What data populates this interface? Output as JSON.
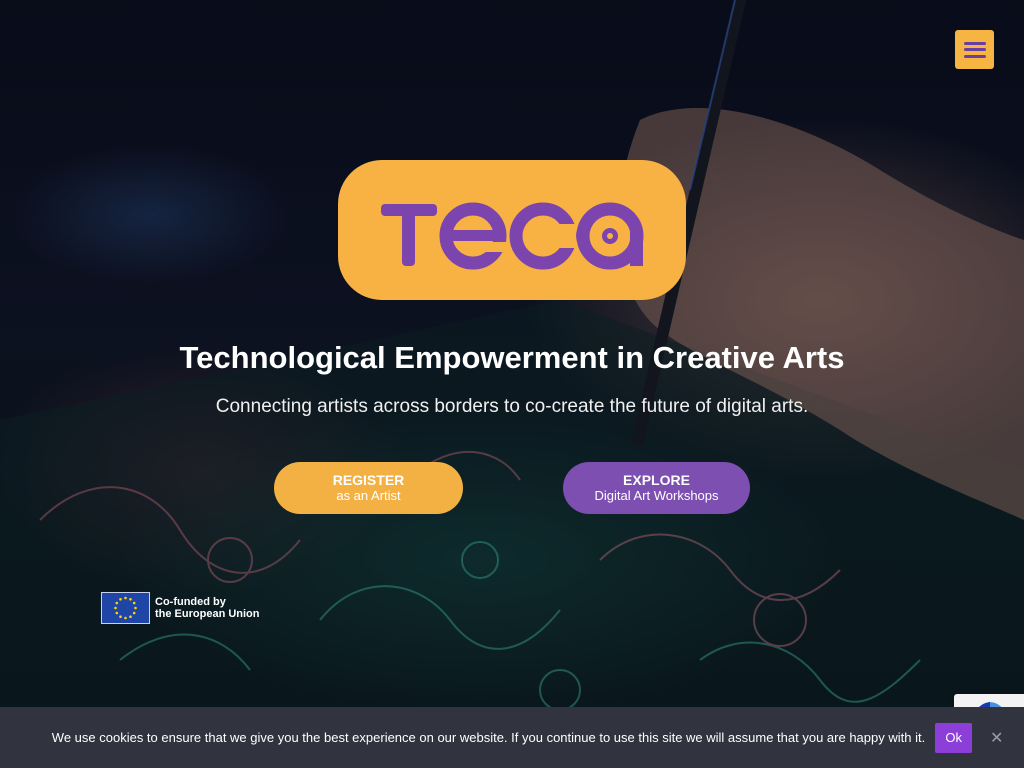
{
  "header": {
    "menu_icon": "hamburger-icon"
  },
  "logo": {
    "text": "TECA"
  },
  "hero": {
    "headline": "Technological Empowerment in Creative Arts",
    "subline": "Connecting artists across borders to co-create the future of digital arts."
  },
  "cta": {
    "register": {
      "line1": "REGISTER",
      "line2": "as an Artist"
    },
    "explore": {
      "line1": "EXPLORE",
      "line2": "Digital Art Workshops"
    }
  },
  "eu_badge": {
    "line1": "Co-funded by",
    "line2": "the European Union"
  },
  "cookie": {
    "text": "We use cookies to ensure that we give you the best experience on our website. If you continue to use this site we will assume that you are happy with it.",
    "ok_label": "Ok",
    "close_glyph": "✕"
  },
  "colors": {
    "brand_orange": "#f8b143",
    "brand_purple": "#7c4fb0",
    "cookie_bg": "#31333f",
    "cookie_ok": "#8c3fd8"
  }
}
